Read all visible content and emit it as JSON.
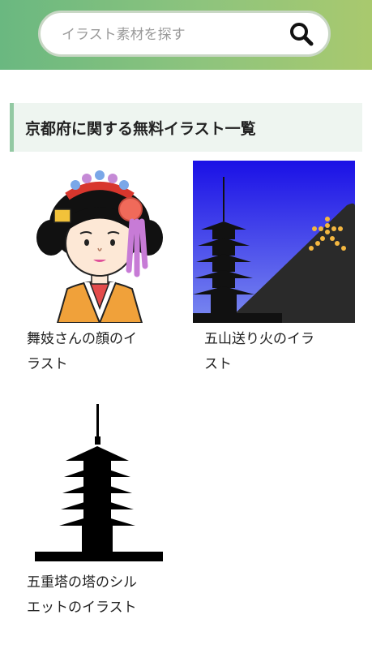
{
  "search": {
    "placeholder": "イラスト素材を探す",
    "value": ""
  },
  "section": {
    "title": "京都府に関する無料イラスト一覧"
  },
  "items": [
    {
      "caption_line1": "舞妓さんの顔のイ",
      "caption_line2": "ラスト"
    },
    {
      "caption_line1": "五山送り火のイラ",
      "caption_line2": "スト"
    },
    {
      "caption_line1": "五重塔の塔のシル",
      "caption_line2": "エットのイラスト"
    }
  ],
  "colors": {
    "header_start": "#6ab880",
    "header_end": "#a9c96e",
    "section_bg": "#eef5f0",
    "section_border": "#93c9a3"
  },
  "icons": {
    "search": "search-icon"
  }
}
